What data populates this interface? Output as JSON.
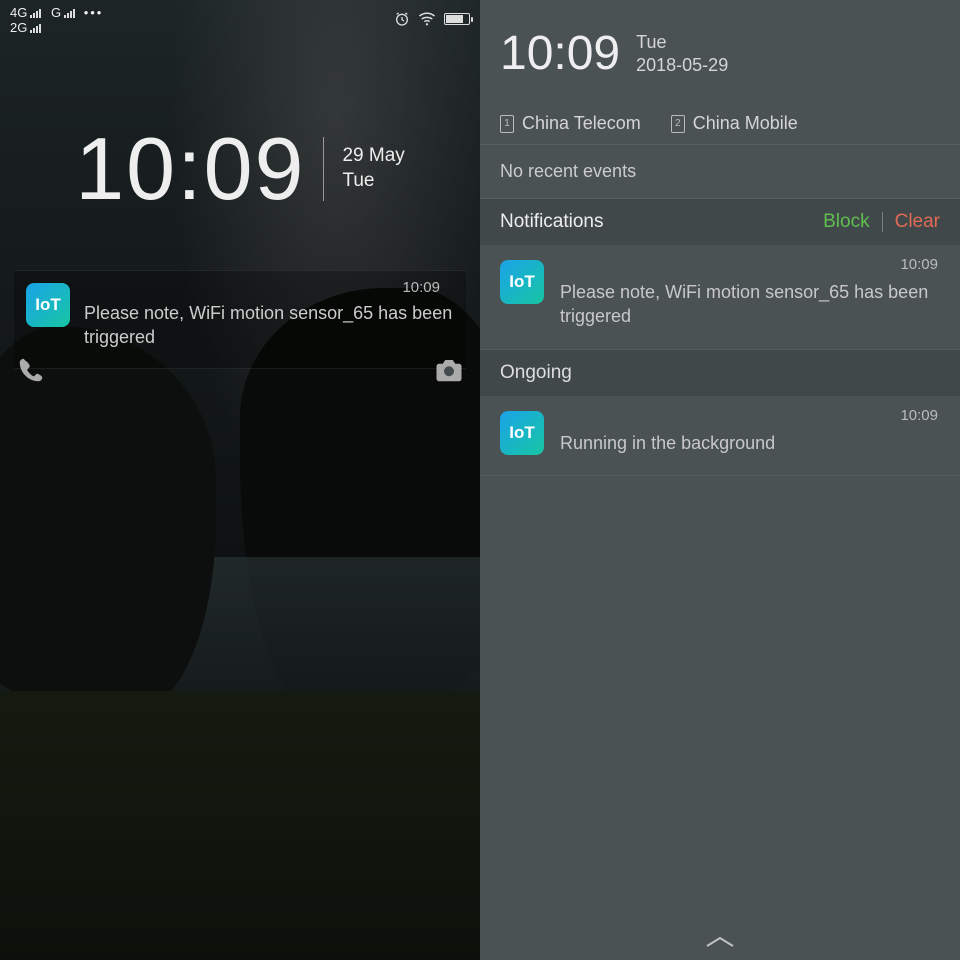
{
  "left": {
    "status": {
      "net1": "4G",
      "net2": "2G",
      "netG": "G"
    },
    "time": "10:09",
    "date_line1": "29 May",
    "date_line2": "Tue",
    "notification": {
      "app_icon_label": "IoT",
      "time": "10:09",
      "text": "Please note, WiFi motion sensor_65 has been triggered"
    }
  },
  "right": {
    "time": "10:09",
    "day": "Tue",
    "date": "2018-05-29",
    "carriers": {
      "sim1_num": "1",
      "sim1_name": "China Telecom",
      "sim2_num": "2",
      "sim2_name": "China Mobile"
    },
    "no_events": "No recent events",
    "notif_header": "Notifications",
    "block": "Block",
    "clear": "Clear",
    "notification": {
      "app_icon_label": "IoT",
      "time": "10:09",
      "text": "Please note, WiFi motion sensor_65 has been triggered"
    },
    "ongoing_header": "Ongoing",
    "ongoing": {
      "app_icon_label": "IoT",
      "time": "10:09",
      "text": "Running in the background"
    }
  }
}
